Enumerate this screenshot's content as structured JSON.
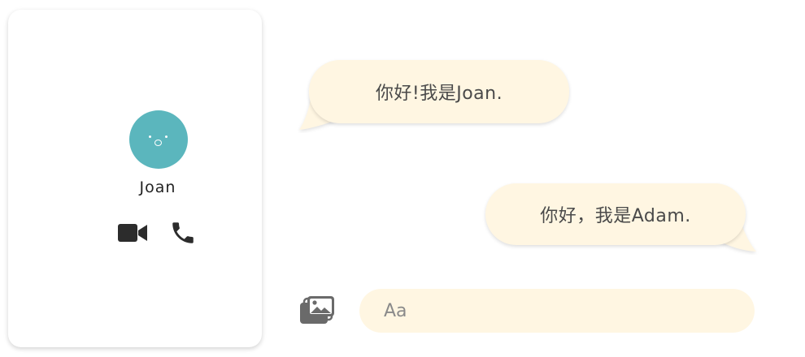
{
  "contact": {
    "name": "Joan",
    "avatar_color": "#5bb6bd",
    "actions": [
      {
        "icon": "video-camera-icon"
      },
      {
        "icon": "phone-icon"
      }
    ]
  },
  "messages": [
    {
      "direction": "incoming",
      "text": "你好!我是Joan."
    },
    {
      "direction": "outgoing",
      "text": "你好，我是Adam."
    }
  ],
  "composer": {
    "placeholder": "Aa",
    "attach_icon": "image-gallery-icon"
  },
  "colors": {
    "bubble": "#fff6e2",
    "icon": "#2c2c2c",
    "muted_icon": "#6a6a6a"
  }
}
